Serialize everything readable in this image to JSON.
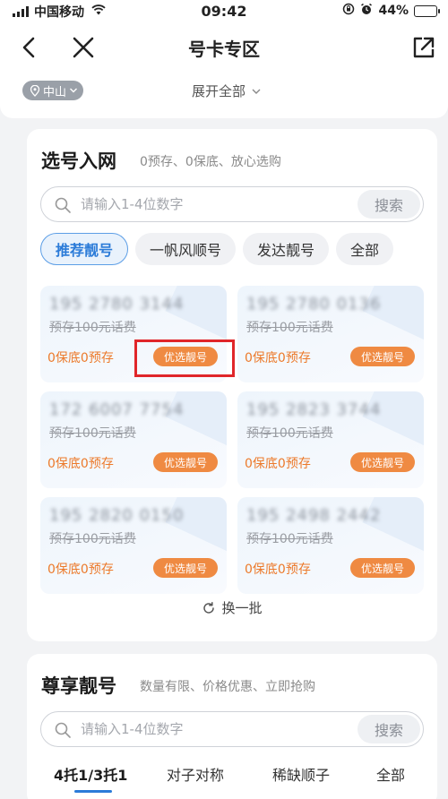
{
  "status_bar": {
    "carrier": "中国移动",
    "time": "09:42",
    "battery": "44%",
    "battery_level": 0.44
  },
  "nav": {
    "title": "号卡专区",
    "back_icon": "chevron-left-icon",
    "close_icon": "close-icon",
    "share_icon": "share-icon"
  },
  "filter": {
    "city": "中山",
    "expand": "展开全部"
  },
  "section1": {
    "title": "选号入网",
    "subtitle": "0预存、0保底、放心选购",
    "search_placeholder": "请输入1-4位数字",
    "search_button": "搜索",
    "tabs": [
      "推荐靓号",
      "一帆风顺号",
      "发达靓号",
      "全部"
    ],
    "active_tab": 0,
    "numbers": [
      {
        "number": "195 2780 3144",
        "prestore": "预存100元话费",
        "guarantee": "0保底0预存",
        "badge": "优选靓号"
      },
      {
        "number": "195 2780 0136",
        "prestore": "预存100元话费",
        "guarantee": "0保底0预存",
        "badge": "优选靓号"
      },
      {
        "number": "172 6007 7754",
        "prestore": "预存100元话费",
        "guarantee": "0保底0预存",
        "badge": "优选靓号"
      },
      {
        "number": "195 2823 3744",
        "prestore": "预存100元话费",
        "guarantee": "0保底0预存",
        "badge": "优选靓号"
      },
      {
        "number": "195 2820 0150",
        "prestore": "预存100元话费",
        "guarantee": "0保底0预存",
        "badge": "优选靓号"
      },
      {
        "number": "195 2498 2442",
        "prestore": "预存100元话费",
        "guarantee": "0保底0预存",
        "badge": "优选靓号"
      }
    ],
    "refresh": "换一批"
  },
  "section2": {
    "title": "尊享靓号",
    "subtitle": "数量有限、价格优惠、立即抢购",
    "search_placeholder": "请输入1-4位数字",
    "search_button": "搜索",
    "tabs": [
      "4托1/3托1",
      "对子对称",
      "稀缺顺子",
      "全部"
    ],
    "active_tab": 0
  },
  "colors": {
    "accent_blue": "#2b7bd8",
    "badge_orange": "#ef8a42",
    "guarantee_orange": "#ec7a2b",
    "highlight_red": "#e0262a"
  }
}
